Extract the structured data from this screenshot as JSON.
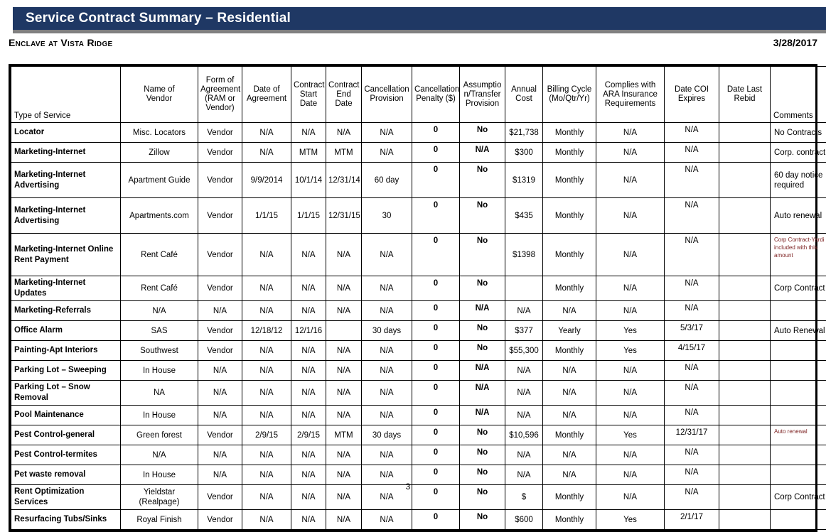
{
  "document": {
    "banner_title": "Service Contract Summary – Residential",
    "property_name": "Enclave at Vista Ridge",
    "report_date": "3/28/2017",
    "page_number": "3",
    "banner_color": "#1F3864",
    "banner_rule_color": "#808080",
    "comment_red_color": "#7B1F1F"
  },
  "table": {
    "headers": [
      "Type of Service",
      "Name of Vendor",
      "Form of Agreement (RAM or Vendor)",
      "Date of Agreement",
      "Contract Start Date",
      "Contract End Date",
      "Cancellation Provision",
      "Cancellation Penalty ($)",
      "Assumption/Transfer Provision",
      "Annual Cost",
      "Billing Cycle (Mo/Qtr/Yr)",
      "Complies with ARA Insurance Requirements",
      "Date COI Expires",
      "Date Last Rebid",
      "Comments"
    ],
    "header_lines": {
      "type_of_service": [
        "Type of Service"
      ],
      "name_of_vendor": [
        "Name of",
        "Vendor"
      ],
      "form_of_agreement": [
        "Form of",
        "Agreement",
        "(RAM or",
        "Vendor)"
      ],
      "date_of_agreement": [
        "Date of",
        "Agreement"
      ],
      "contract_start_date": [
        "Contract",
        "Start",
        "Date"
      ],
      "contract_end_date": [
        "Contract",
        "End",
        "Date"
      ],
      "cancellation_provision": [
        "Cancellation",
        "Provision"
      ],
      "cancellation_penalty": [
        "Cancellation",
        "Penalty ($)"
      ],
      "assumption_transfer": [
        "Assumptio",
        "n/Transfer",
        "Provision"
      ],
      "annual_cost": [
        "Annual",
        "Cost"
      ],
      "billing_cycle": [
        "Billing Cycle",
        "(Mo/Qtr/Yr)"
      ],
      "complies_ara": [
        "Complies with",
        "ARA Insurance",
        "Requirements"
      ],
      "date_coi_expires": [
        "Date COI",
        "Expires"
      ],
      "date_last_rebid": [
        "Date Last",
        "Rebid"
      ],
      "comments": [
        "Comments"
      ]
    },
    "rows": [
      {
        "service": "Locator",
        "vendor": "Misc. Locators",
        "form": "Vendor",
        "date_agreement": "N/A",
        "start_date": "N/A",
        "end_date": "N/A",
        "cancel_provision": "N/A",
        "cancel_penalty": "0",
        "assumption": "No",
        "annual_cost": "$21,738",
        "billing_cycle": "Monthly",
        "complies": "N/A",
        "coi_expires": "N/A",
        "last_rebid": "",
        "comments": "No Contracts"
      },
      {
        "service": "Marketing-Internet",
        "vendor": "Zillow",
        "form": "Vendor",
        "date_agreement": "N/A",
        "start_date": "MTM",
        "end_date": "MTM",
        "cancel_provision": "N/A",
        "cancel_penalty": "0",
        "assumption": "N/A",
        "annual_cost": "$300",
        "billing_cycle": "Monthly",
        "complies": "N/A",
        "coi_expires": "N/A",
        "last_rebid": "",
        "comments": "Corp. contract"
      },
      {
        "service": "Marketing-Internet Advertising",
        "vendor": "Apartment Guide",
        "form": "Vendor",
        "date_agreement": "9/9/2014",
        "start_date": "10/1/14",
        "end_date": "12/31/14",
        "cancel_provision": "60 day",
        "cancel_penalty": "0",
        "assumption": "No",
        "annual_cost": "$1319",
        "billing_cycle": "Monthly",
        "complies": "N/A",
        "coi_expires": "N/A",
        "last_rebid": "",
        "comments": "60 day notice required"
      },
      {
        "service": "Marketing-Internet Advertising",
        "vendor": "Apartments.com",
        "form": "Vendor",
        "date_agreement": "1/1/15",
        "start_date": "1/1/15",
        "end_date": "12/31/15",
        "cancel_provision": "30",
        "cancel_penalty": "0",
        "assumption": "No",
        "annual_cost": "$435",
        "billing_cycle": "Monthly",
        "complies": "N/A",
        "coi_expires": "N/A",
        "last_rebid": "",
        "comments": "Auto renewal"
      },
      {
        "service": "Marketing-Internet Online Rent Payment",
        "vendor": "Rent Café",
        "form": "Vendor",
        "date_agreement": "N/A",
        "start_date": "N/A",
        "end_date": "N/A",
        "cancel_provision": "N/A",
        "cancel_penalty": "0",
        "assumption": "No",
        "annual_cost": "$1398",
        "billing_cycle": "Monthly",
        "complies": "N/A",
        "coi_expires": "N/A",
        "last_rebid": "",
        "comments": "Corp Contract-Yardi is included with this amount"
      },
      {
        "service": "Marketing-Internet Updates",
        "vendor": "Rent Café",
        "form": "Vendor",
        "date_agreement": "N/A",
        "start_date": "N/A",
        "end_date": "N/A",
        "cancel_provision": "N/A",
        "cancel_penalty": "0",
        "assumption": "No",
        "annual_cost": "",
        "billing_cycle": "Monthly",
        "complies": "N/A",
        "coi_expires": "N/A",
        "last_rebid": "",
        "comments": "Corp Contract"
      },
      {
        "service": "Marketing-Referrals",
        "vendor": "N/A",
        "form": "N/A",
        "date_agreement": "N/A",
        "start_date": "N/A",
        "end_date": "N/A",
        "cancel_provision": "N/A",
        "cancel_penalty": "0",
        "assumption": "N/A",
        "annual_cost": "N/A",
        "billing_cycle": "N/A",
        "complies": "N/A",
        "coi_expires": "N/A",
        "last_rebid": "",
        "comments": ""
      },
      {
        "service": "Office Alarm",
        "vendor": "SAS",
        "form": "Vendor",
        "date_agreement": "12/18/12",
        "start_date": "12/1/16",
        "end_date": "",
        "cancel_provision": "30 days",
        "cancel_penalty": "0",
        "assumption": "No",
        "annual_cost": "$377",
        "billing_cycle": "Yearly",
        "complies": "Yes",
        "coi_expires": "5/3/17",
        "last_rebid": "",
        "comments": "Auto Renewal"
      },
      {
        "service": "Painting-Apt Interiors",
        "vendor": "Southwest",
        "form": "Vendor",
        "date_agreement": "N/A",
        "start_date": "N/A",
        "end_date": "N/A",
        "cancel_provision": "N/A",
        "cancel_penalty": "0",
        "assumption": "No",
        "annual_cost": "$55,300",
        "billing_cycle": "Monthly",
        "complies": "Yes",
        "coi_expires": "4/15/17",
        "last_rebid": "",
        "comments": ""
      },
      {
        "service": "Parking Lot – Sweeping",
        "vendor": "In House",
        "form": "N/A",
        "date_agreement": "N/A",
        "start_date": "N/A",
        "end_date": "N/A",
        "cancel_provision": "N/A",
        "cancel_penalty": "0",
        "assumption": "N/A",
        "annual_cost": "N/A",
        "billing_cycle": "N/A",
        "complies": "N/A",
        "coi_expires": "N/A",
        "last_rebid": "",
        "comments": ""
      },
      {
        "service": "Parking Lot – Snow Removal",
        "vendor": "NA",
        "form": "N/A",
        "date_agreement": "N/A",
        "start_date": "N/A",
        "end_date": "N/A",
        "cancel_provision": "N/A",
        "cancel_penalty": "0",
        "assumption": "N/A",
        "annual_cost": "N/A",
        "billing_cycle": "N/A",
        "complies": "N/A",
        "coi_expires": "N/A",
        "last_rebid": "",
        "comments": ""
      },
      {
        "service": "Pool Maintenance",
        "vendor": "In House",
        "form": "N/A",
        "date_agreement": "N/A",
        "start_date": "N/A",
        "end_date": "N/A",
        "cancel_provision": "N/A",
        "cancel_penalty": "0",
        "assumption": "N/A",
        "annual_cost": "N/A",
        "billing_cycle": "N/A",
        "complies": "N/A",
        "coi_expires": "N/A",
        "last_rebid": "",
        "comments": ""
      },
      {
        "service": "Pest Control-general",
        "vendor": "Green forest",
        "form": "Vendor",
        "date_agreement": "2/9/15",
        "start_date": "2/9/15",
        "end_date": "MTM",
        "cancel_provision": "30 days",
        "cancel_penalty": "0",
        "assumption": "No",
        "annual_cost": "$10,596",
        "billing_cycle": "Monthly",
        "complies": "Yes",
        "coi_expires": "12/31/17",
        "last_rebid": "",
        "comments": "Auto renewal"
      },
      {
        "service": "Pest Control-termites",
        "vendor": "N/A",
        "form": "N/A",
        "date_agreement": "N/A",
        "start_date": "N/A",
        "end_date": "N/A",
        "cancel_provision": "N/A",
        "cancel_penalty": "0",
        "assumption": "No",
        "annual_cost": "N/A",
        "billing_cycle": "N/A",
        "complies": "N/A",
        "coi_expires": "N/A",
        "last_rebid": "",
        "comments": ""
      },
      {
        "service": "Pet waste removal",
        "vendor": "In House",
        "form": "N/A",
        "date_agreement": "N/A",
        "start_date": "N/A",
        "end_date": "N/A",
        "cancel_provision": "N/A",
        "cancel_penalty": "0",
        "assumption": "No",
        "annual_cost": "N/A",
        "billing_cycle": "N/A",
        "complies": "N/A",
        "coi_expires": "N/A",
        "last_rebid": "",
        "comments": ""
      },
      {
        "service": "Rent Optimization Services",
        "vendor": "Yieldstar (Realpage)",
        "form": "Vendor",
        "date_agreement": "N/A",
        "start_date": "N/A",
        "end_date": "N/A",
        "cancel_provision": "N/A",
        "cancel_penalty": "0",
        "assumption": "No",
        "annual_cost": "$",
        "billing_cycle": "Monthly",
        "complies": "N/A",
        "coi_expires": "N/A",
        "last_rebid": "",
        "comments": "Corp Contract"
      },
      {
        "service": "Resurfacing Tubs/Sinks",
        "vendor": "Royal Finish",
        "form": "Vendor",
        "date_agreement": "N/A",
        "start_date": "N/A",
        "end_date": "N/A",
        "cancel_provision": "N/A",
        "cancel_penalty": "0",
        "assumption": "No",
        "annual_cost": "$600",
        "billing_cycle": "Monthly",
        "complies": "Yes",
        "coi_expires": "2/1/17",
        "last_rebid": "",
        "comments": ""
      }
    ]
  }
}
